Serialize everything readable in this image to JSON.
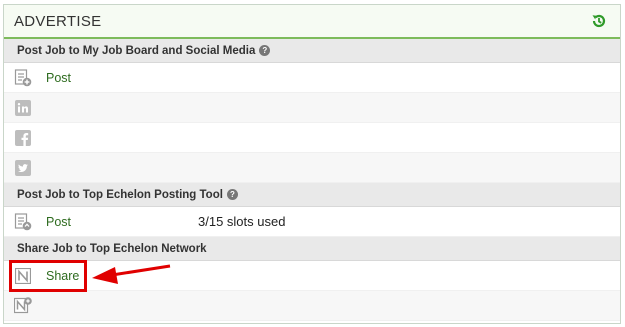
{
  "panel": {
    "title": "ADVERTISE",
    "history_icon": "history-icon"
  },
  "section1": {
    "title": "Post Job to My Job Board and Social Media",
    "help_icon": "?",
    "rows": [
      {
        "icon": "post-document-icon",
        "label": "Post"
      },
      {
        "icon": "linkedin-icon"
      },
      {
        "icon": "facebook-icon"
      },
      {
        "icon": "twitter-icon"
      }
    ]
  },
  "section2": {
    "title": "Post Job to Top Echelon Posting Tool",
    "help_icon": "?",
    "post_label": "Post",
    "slots_text": "3/15 slots used"
  },
  "section3": {
    "title": "Share Job to Top Echelon Network",
    "share_label": "Share"
  },
  "colors": {
    "accent": "#7dbb5b",
    "link": "#2e6b1f",
    "annotation": "#e00000"
  }
}
